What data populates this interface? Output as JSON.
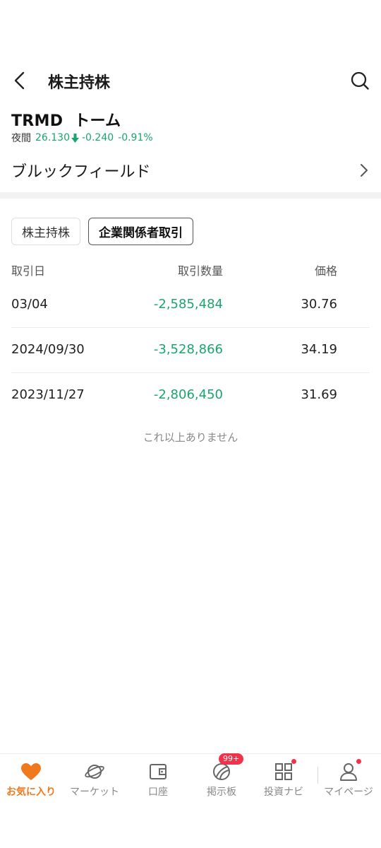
{
  "header": {
    "title": "株主持株",
    "back_icon": "chevron-left-icon",
    "search_icon": "search-icon"
  },
  "stock": {
    "name": "TRMD  トーム",
    "session_label": "夜間",
    "price": "26.130",
    "change": "-0.240",
    "change_pct": "-0.91%",
    "color_down": "#1aa56e"
  },
  "holder": {
    "name": "ブルックフィールド"
  },
  "tabs": [
    {
      "label": "株主持株",
      "active": false
    },
    {
      "label": "企業関係者取引",
      "active": true
    }
  ],
  "table": {
    "headers": {
      "date": "取引日",
      "quantity": "取引数量",
      "price": "価格"
    },
    "rows": [
      {
        "date": "03/04",
        "quantity": "-2,585,484",
        "price": "30.76"
      },
      {
        "date": "2024/09/30",
        "quantity": "-3,528,866",
        "price": "34.19"
      },
      {
        "date": "2023/11/27",
        "quantity": "-2,806,450",
        "price": "31.69"
      }
    ]
  },
  "no_more_text": "これ以上ありません",
  "bottom_nav": {
    "items": [
      {
        "label": "お気に入り",
        "icon": "heart-icon",
        "active": true
      },
      {
        "label": "マーケット",
        "icon": "planet-icon"
      },
      {
        "label": "口座",
        "icon": "wallet-icon"
      },
      {
        "label": "掲示板",
        "icon": "board-icon",
        "badge": "99+"
      },
      {
        "label": "投資ナビ",
        "icon": "grid-icon",
        "dot": true
      },
      {
        "label": "マイページ",
        "icon": "user-icon",
        "dot": true
      }
    ],
    "accent_color": "#f0791e"
  }
}
